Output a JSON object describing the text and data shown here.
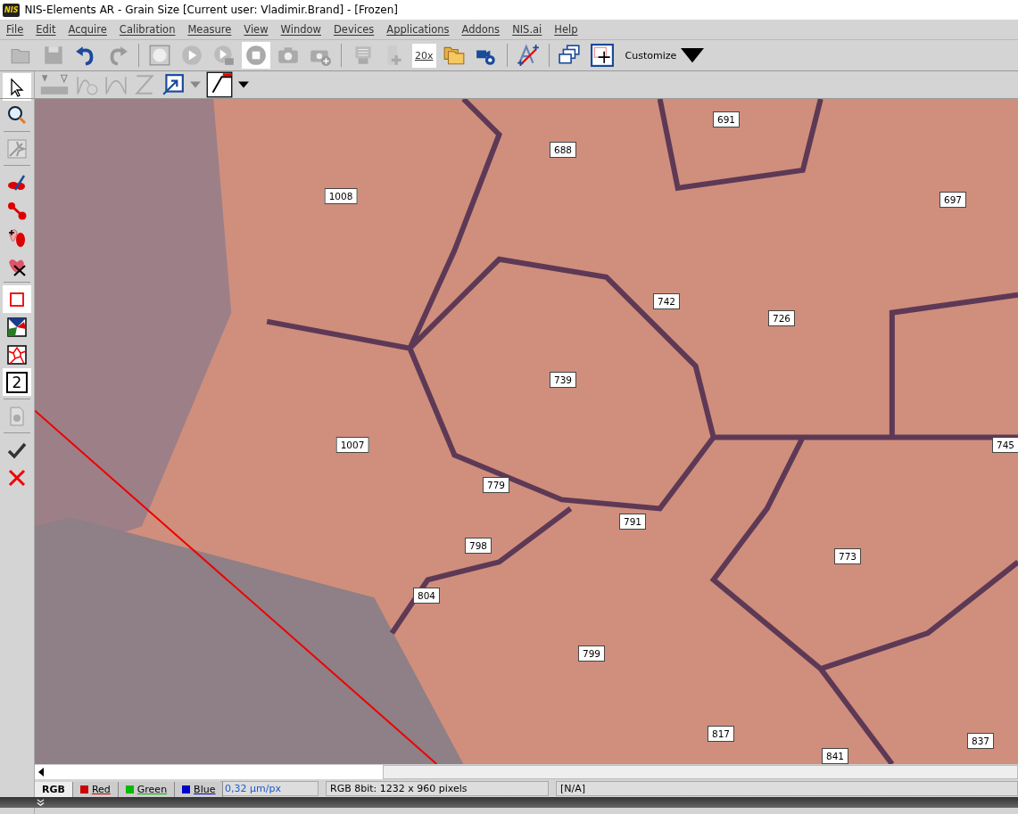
{
  "window": {
    "title": "NIS-Elements AR - Grain Size [Current user: Vladimir.Brand]  - [Frozen]",
    "logo": "NIS"
  },
  "menu": [
    {
      "label": "File"
    },
    {
      "label": "Edit"
    },
    {
      "label": "Acquire"
    },
    {
      "label": "Calibration"
    },
    {
      "label": "Measure"
    },
    {
      "label": "View"
    },
    {
      "label": "Window"
    },
    {
      "label": "Devices"
    },
    {
      "label": "Applications"
    },
    {
      "label": "Addons"
    },
    {
      "label": "NIS.ai"
    },
    {
      "label": "Help"
    }
  ],
  "toolbar": {
    "objective": "20x",
    "customize": "Customize"
  },
  "side_tools": [
    {
      "kind": "pointer",
      "selected": true
    },
    {
      "kind": "zoom",
      "selected": false
    },
    {
      "kind": "sep"
    },
    {
      "kind": "auto",
      "selected": false
    },
    {
      "kind": "sep"
    },
    {
      "kind": "cut",
      "selected": false
    },
    {
      "kind": "connect",
      "selected": false
    },
    {
      "kind": "add",
      "selected": false
    },
    {
      "kind": "delete",
      "selected": false
    },
    {
      "kind": "sep"
    },
    {
      "kind": "rect",
      "selected": true
    },
    {
      "kind": "fill",
      "selected": false
    },
    {
      "kind": "grid",
      "selected": false
    },
    {
      "kind": "number",
      "label": "2",
      "selected": true
    },
    {
      "kind": "sep"
    },
    {
      "kind": "doc",
      "selected": false
    },
    {
      "kind": "sep"
    },
    {
      "kind": "ok",
      "selected": false
    },
    {
      "kind": "cancel",
      "selected": false
    }
  ],
  "grains": [
    {
      "label": "1008"
    },
    {
      "label": "688"
    },
    {
      "label": "691"
    },
    {
      "label": "697"
    },
    {
      "label": "742"
    },
    {
      "label": "726"
    },
    {
      "label": "739"
    },
    {
      "label": "1007"
    },
    {
      "label": "745"
    },
    {
      "label": "779"
    },
    {
      "label": "791"
    },
    {
      "label": "798"
    },
    {
      "label": "804"
    },
    {
      "label": "773"
    },
    {
      "label": "799"
    },
    {
      "label": "817"
    },
    {
      "label": "837"
    },
    {
      "label": "841"
    }
  ],
  "channel_tabs": [
    {
      "label": "RGB",
      "selected": true
    },
    {
      "label": "Red",
      "selected": false,
      "color": "#cc0000"
    },
    {
      "label": "Green",
      "selected": false,
      "color": "#00bb00"
    },
    {
      "label": "Blue",
      "selected": false,
      "color": "#0000cc"
    }
  ],
  "status_bar": {
    "calibration": "0,32 µm/px",
    "format": "RGB 8bit: 1232 x 960 pixels",
    "value": "[N/A]"
  }
}
